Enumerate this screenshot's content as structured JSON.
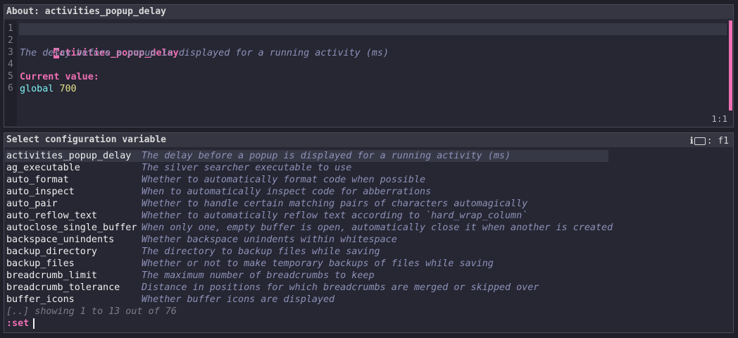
{
  "about": {
    "title": "About: activities_popup_delay",
    "line_numbers": [
      "1",
      "2",
      "3",
      "4",
      "5",
      "6"
    ],
    "variable_first_char": "a",
    "variable_rest": "ctivities_popup_delay",
    "description": "The delay before a popup is displayed for a running activity (ms)",
    "current_value_label": "Current value:",
    "scope": "global",
    "value": "700",
    "cursor_position": "1:1"
  },
  "select": {
    "title": "Select configuration variable",
    "indicator_info": "ℹ",
    "indicator_key": "f1",
    "items": [
      {
        "name": "activities_popup_delay",
        "desc": "The delay before a popup is displayed for a running activity (ms)"
      },
      {
        "name": "ag_executable",
        "desc": "The silver searcher executable to use"
      },
      {
        "name": "auto_format",
        "desc": "Whether to automatically format code when possible"
      },
      {
        "name": "auto_inspect",
        "desc": "When to automatically inspect code for abberrations"
      },
      {
        "name": "auto_pair",
        "desc": "Whether to handle certain matching pairs of characters automagically"
      },
      {
        "name": "auto_reflow_text",
        "desc": "Whether to automatically reflow text according to `hard_wrap_column`"
      },
      {
        "name": "autoclose_single_buffer",
        "desc": "When only one, empty buffer is open, automatically close it when another is created"
      },
      {
        "name": "backspace_unindents",
        "desc": "Whether backspace unindents within whitespace"
      },
      {
        "name": "backup_directory",
        "desc": "The directory to backup files while saving"
      },
      {
        "name": "backup_files",
        "desc": "Whether or not to make temporary backups of files while saving"
      },
      {
        "name": "breadcrumb_limit",
        "desc": "The maximum number of breadcrumbs to keep"
      },
      {
        "name": "breadcrumb_tolerance",
        "desc": "Distance in positions for which breadcrumbs are merged or skipped over"
      },
      {
        "name": "buffer_icons",
        "desc": "Whether buffer icons are displayed"
      }
    ],
    "footer": "[..] showing 1 to 13 out of 76",
    "prompt": ":set",
    "input_value": ""
  }
}
